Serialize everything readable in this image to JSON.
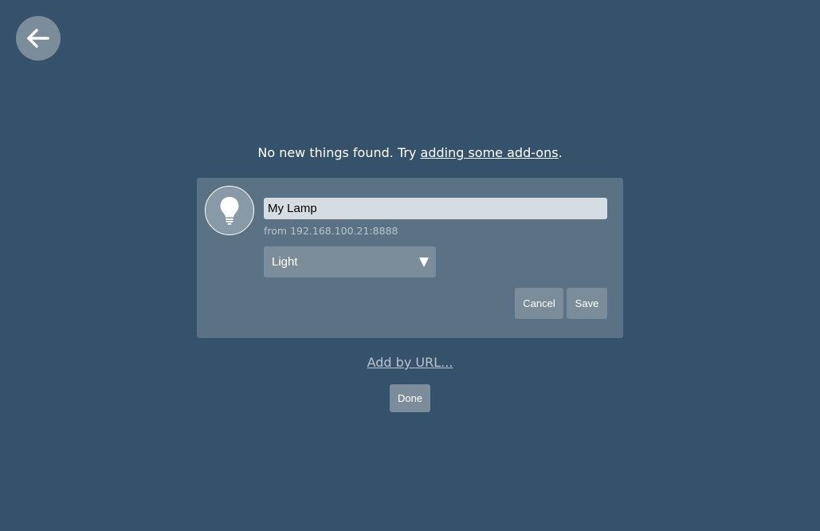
{
  "navigation": {
    "back_icon": "arrow-left-icon"
  },
  "message": {
    "prefix": "No new things found. Try ",
    "link_text": "adding some add-ons",
    "suffix": "."
  },
  "new_thing": {
    "icon": "lightbulb-icon",
    "name_value": "My Lamp",
    "origin": "from 192.168.100.21:8888",
    "type_selected": "Light",
    "cancel_label": "Cancel",
    "save_label": "Save"
  },
  "add_by_url_label": "Add by URL...",
  "done_label": "Done",
  "colors": {
    "background": "#36526a",
    "card": "#5a7284",
    "button": "#7b8c9b",
    "input": "#d6dde2",
    "muted_text": "#b8c5cf"
  }
}
